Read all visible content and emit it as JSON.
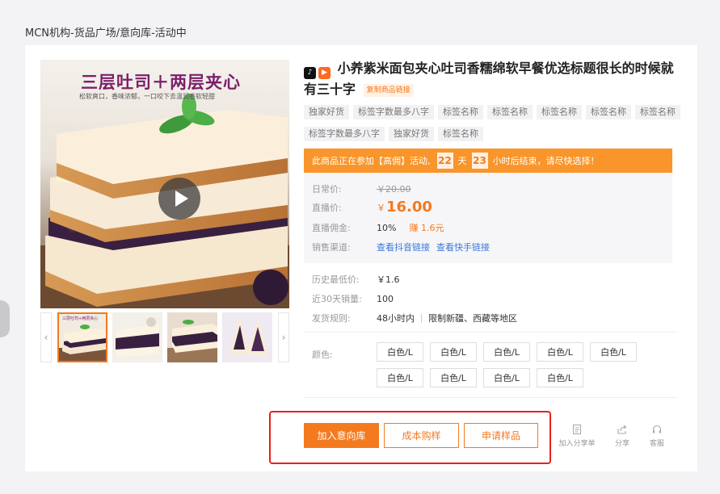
{
  "breadcrumb": "MCN机构-货品广场/意向库-活动中",
  "gallery": {
    "banner_title": "三层吐司＋两层夹心",
    "banner_subtitle": "松软爽口，香味浓郁，一口咬下去温润香软轻甜",
    "thumb_banner_title": "三层吐司+两层夹心"
  },
  "product": {
    "title": "小养紫米面包夹心吐司香糯绵软早餐优选标题很长的时候就有三十字",
    "copy_link": "复制商品链接",
    "tags": [
      "独家好货",
      "标签字数最多八字",
      "标签名称",
      "标签名称",
      "标签名称",
      "标签名称",
      "标签名称",
      "标签字数最多八字",
      "独家好货",
      "标签名称"
    ]
  },
  "promo": {
    "text": "此商品正在参加【高佣】活动,",
    "days": "22",
    "day_unit": "天",
    "hours": "23",
    "suffix": "小时后结束，请尽快选择！"
  },
  "prices": {
    "daily_label": "日常价:",
    "daily_value": "￥20.00",
    "live_label": "直播价:",
    "live_currency": "￥",
    "live_value": "16.00",
    "commission_label": "直播佣金:",
    "commission_rate": "10%",
    "commission_earn": "赚 1.6元",
    "channel_label": "销售渠道:",
    "channel_douyin": "查看抖音链接",
    "channel_kuaishou": "查看快手链接"
  },
  "info": {
    "hist_low_label": "历史最低价:",
    "hist_low_value": "￥1.6",
    "sales_label": "近30天销量:",
    "sales_value": "100",
    "ship_label": "发货规则:",
    "ship_time": "48小时内",
    "ship_limit": "限制新疆、西藏等地区"
  },
  "color": {
    "label": "颜色:",
    "options": [
      "白色/L",
      "白色/L",
      "白色/L",
      "白色/L",
      "白色/L",
      "白色/L",
      "白色/L",
      "白色/L",
      "白色/L"
    ]
  },
  "actions": {
    "add_intent": "加入意向库",
    "cost_buy": "成本购样",
    "apply_sample": "申请样品",
    "add_share": "加入分享单",
    "share": "分享",
    "service": "客服"
  },
  "colors": {
    "accent": "#f47a1f",
    "promo_bg": "#f9952a",
    "highlight_border": "#e8201a",
    "link": "#3b78d8"
  }
}
